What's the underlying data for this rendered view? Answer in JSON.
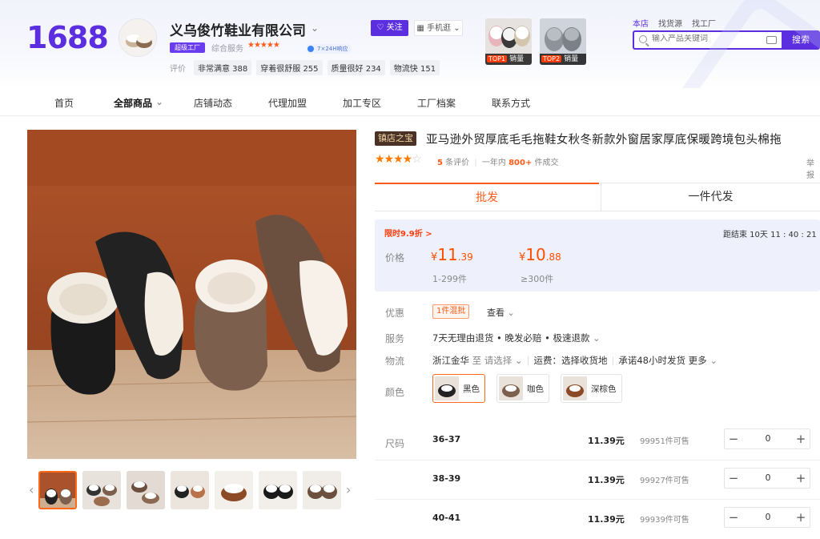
{
  "header": {
    "logo": "1688",
    "shop_name": "义乌俊竹鞋业有限公司",
    "factory_badge": "超级工厂",
    "service_label": "综合服务",
    "service_stars": "★★★★★",
    "response_badge": "7×24H响应",
    "rating_label": "评价",
    "rating_chips": [
      "非常满意 388",
      "穿着很舒服 255",
      "质量很好 234",
      "物流快 151"
    ],
    "follow_label": "关注",
    "mobile_label": "手机逛",
    "top_items": [
      {
        "rank": "TOP1",
        "label": "销量"
      },
      {
        "rank": "TOP2",
        "label": "销量"
      }
    ],
    "search_tabs": [
      "本店",
      "找货源",
      "找工厂"
    ],
    "search_placeholder": "输入产品关键词",
    "search_button": "搜索"
  },
  "nav": {
    "items": [
      "首页",
      "全部商品",
      "店铺动态",
      "代理加盟",
      "加工专区",
      "工厂档案",
      "联系方式"
    ]
  },
  "product": {
    "shop_tag": "镇店之宝",
    "title": "亚马逊外贸厚底毛毛拖鞋女秋冬新款外窗居家厚底保暖跨境包头棉拖",
    "report": "举报",
    "rating": 4,
    "review_count": "5",
    "review_label": "条评价",
    "year_label": "一年内",
    "year_sales": "800+",
    "sales_label": "件成交"
  },
  "tabs": {
    "wholesale": "批发",
    "dropship": "一件代发"
  },
  "pricing": {
    "promo": "限时9.9折 >",
    "countdown": "距结束 10天 11 : 40 : 21",
    "price_label": "价格",
    "tiers": [
      {
        "symbol": "¥",
        "int": "11",
        "dec": ".39",
        "range": "1-299件"
      },
      {
        "symbol": "¥",
        "int": "10",
        "dec": ".88",
        "range": "≥300件"
      }
    ]
  },
  "attributes": {
    "discount_label": "优惠",
    "discount_badge": "1件混批",
    "view_label": "查看",
    "service_label": "服务",
    "service_text": "7天无理由退货 • 晚发必赔 • 极速退款",
    "logistics_label": "物流",
    "origin": "浙江金华",
    "to_label": "至 请选择",
    "freight": "运费：选择收货地",
    "promise": "承诺48小时发货",
    "more": "更多",
    "color_label": "颜色",
    "colors": [
      "黑色",
      "咖色",
      "深棕色"
    ],
    "size_label": "尺码"
  },
  "sizes": [
    {
      "size": "36-37",
      "price": "11.39元",
      "stock": "99951件可售",
      "qty": "0"
    },
    {
      "size": "38-39",
      "price": "11.39元",
      "stock": "99927件可售",
      "qty": "0"
    },
    {
      "size": "40-41",
      "price": "11.39元",
      "stock": "99939件可售",
      "qty": "0"
    }
  ],
  "colors": {
    "brand": "#5b2fe0",
    "accent": "#ff5b18"
  },
  "icons": [
    "chevron-down-icon",
    "heart-icon",
    "grid-icon",
    "search-icon",
    "camera-icon",
    "minus-icon",
    "plus-icon",
    "chevron-left-icon",
    "chevron-right-icon"
  ]
}
